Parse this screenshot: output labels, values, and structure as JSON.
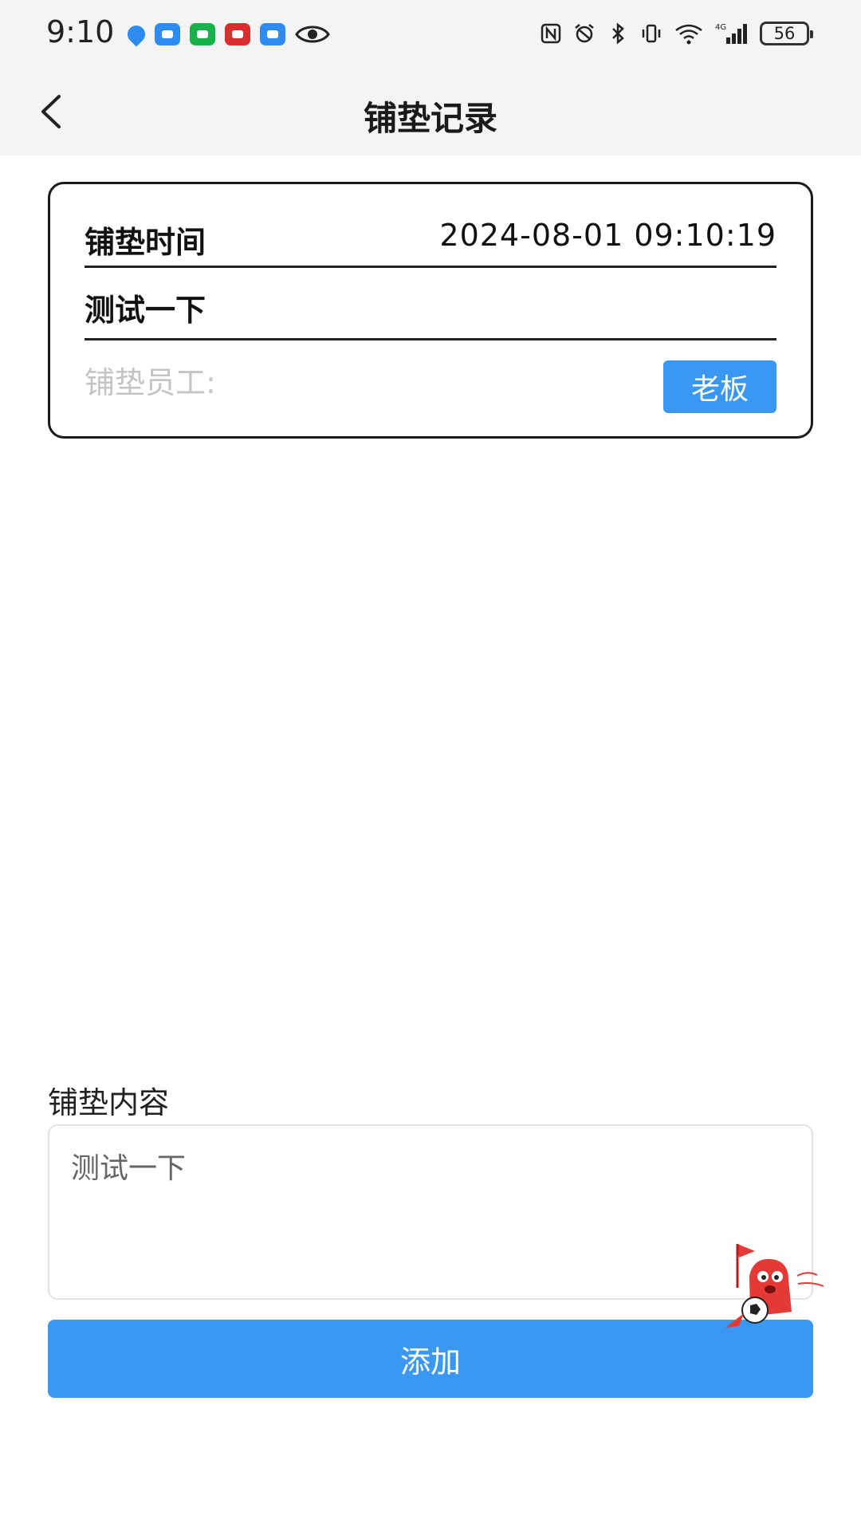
{
  "status_bar": {
    "time": "9:10",
    "battery": "56",
    "left_icons": [
      "shield-app-icon",
      "message-app-icon",
      "wechat-icon",
      "news-app-icon",
      "message-app-icon",
      "eye-icon"
    ],
    "right_icons": [
      "nfc-icon",
      "alarm-icon",
      "bluetooth-icon",
      "vibrate-icon",
      "wifi-icon",
      "signal-4g-icon",
      "battery-icon"
    ]
  },
  "nav": {
    "title": "铺垫记录",
    "back_icon": "chevron-left-icon"
  },
  "record": {
    "time_label": "铺垫时间",
    "time_value": "2024-08-01 09:10:19",
    "content": "测试一下",
    "staff_label": "铺垫员工:",
    "staff_tag": "老板"
  },
  "form": {
    "content_label": "铺垫内容",
    "content_value": "测试一下",
    "add_label": "添加"
  },
  "colors": {
    "accent": "#3a97f2",
    "bar_bg": "#f4f4f4",
    "placeholder": "#c4c4c4"
  }
}
